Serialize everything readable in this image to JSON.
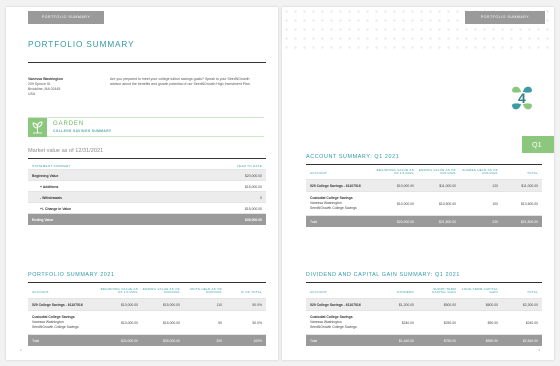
{
  "left_page": {
    "tab_label": "PORTFOLIO SUMMARY",
    "title": "PORTFOLIO SUMMARY",
    "client": {
      "name": "Vanessa Washington",
      "street": "209 Spruce St.",
      "city": "Brookline, MA 02445",
      "country": "USA"
    },
    "intro_text": "Are you prepared to meet your college tuition savings goals? Speak to your SeedNGrowth advisor about the benefits and growth potential of our SeedNGrowth High Investment Plan.",
    "banner": {
      "title": "GARDEN",
      "subtitle": "COLLEGE SAVINGS SUMMARY"
    },
    "market_value_label": "Market value as of 12/31/2021",
    "statement": {
      "headers": [
        "STATEMENT SUMMARY",
        "YEAR TO DATE"
      ],
      "rows": [
        {
          "label": "Beginning Value",
          "value": "$20,000.00"
        },
        {
          "label": "+ Additions",
          "value": "$15,000.00"
        },
        {
          "label": "- Withdrawals",
          "value": "0"
        },
        {
          "label": "+/- Change in Value",
          "value": "$15,000.00"
        },
        {
          "label": "Ending Value",
          "value": "$35,000.00"
        }
      ]
    },
    "portfolio": {
      "title": "PORTFOLIO SUMMARY 2021",
      "headers": [
        "ACCOUNT",
        "BEGINNING VALUE AS OF 1/1/2021",
        "ENDING VALUE AS OF 9/30/2021",
        "UNITS HELD AS OF 9/30/2021",
        "% OF TOTAL"
      ],
      "rows": [
        {
          "account": "529 College Savings - 61107516",
          "sub1": "",
          "sub2": "",
          "beg": "$10,000.00",
          "end": "$15,000.00",
          "units": "110",
          "pct": "50.0%"
        },
        {
          "account": "Custodial College Savings",
          "sub1": "Vanessa Washington",
          "sub2": "SeedNGrowth College Savings",
          "beg": "$10,000.00",
          "end": "$15,000.00",
          "units": "90",
          "pct": "50.0%"
        },
        {
          "account": "Total",
          "sub1": "",
          "sub2": "",
          "beg": "$20,000.00",
          "end": "$35,000.00",
          "units": "200",
          "pct": "100%"
        }
      ]
    },
    "page_number": "2"
  },
  "right_page": {
    "tab_label": "PORTFOLIO SUMMARY",
    "logo_char": "4",
    "quarter_label": "Q1",
    "account_summary": {
      "title": "ACCOUNT SUMMARY: Q1 2021",
      "headers": [
        "ACCOUNT",
        "BEGINNING VALUE AS OF 1/1/2021",
        "ENDING VALUE AS OF 3/31/2021",
        "SHARES HELD AS OF 3/31/2021",
        "TOTAL"
      ],
      "rows": [
        {
          "account": "529 College Savings - 61107516",
          "sub1": "",
          "sub2": "",
          "beg": "$10,000.00",
          "end": "$11,000.00",
          "shares": "120",
          "total": "$11,000.00"
        },
        {
          "account": "Custodial College Savings",
          "sub1": "Vanessa Washington",
          "sub2": "SeedNGrowth College Savings",
          "beg": "$10,000.00",
          "end": "$10,500.00",
          "shares": "100",
          "total": "$10,500.00"
        },
        {
          "account": "Total",
          "sub1": "",
          "sub2": "",
          "beg": "$20,000.00",
          "end": "$21,500.00",
          "shares": "220",
          "total": "$21,500.00"
        }
      ]
    },
    "dividend": {
      "title": "DIVIDEND AND CAPITAL GAIN SUMMARY: Q1 2021",
      "headers": [
        "ACCOUNT",
        "DIVIDEND",
        "SHORT-TERM CAPITAL GAIN",
        "LONG-TERM CAPITAL GAIN",
        "TOTAL"
      ],
      "rows": [
        {
          "account": "529 College Savings - 61107516",
          "sub1": "",
          "sub2": "",
          "div": "$1,200.00",
          "st": "$500.00",
          "lt": "$600.00",
          "total": "$2,300.00"
        },
        {
          "account": "Custodial College Savings",
          "sub1": "Vanessa Washington",
          "sub2": "SeedNGrowth College Savings",
          "div": "$240.00",
          "st": "$250.00",
          "lt": "$90.00",
          "total": "$240.00"
        },
        {
          "account": "Total",
          "sub1": "",
          "sub2": "",
          "div": "$1,440.00",
          "st": "$750.00",
          "lt": "$590.00",
          "total": "$2,540.00"
        }
      ]
    },
    "page_number": "3"
  },
  "colors": {
    "teal": "#2f9aa3",
    "green": "#8cc77e",
    "gray": "#9a9a9a",
    "shade": "#ececec"
  }
}
